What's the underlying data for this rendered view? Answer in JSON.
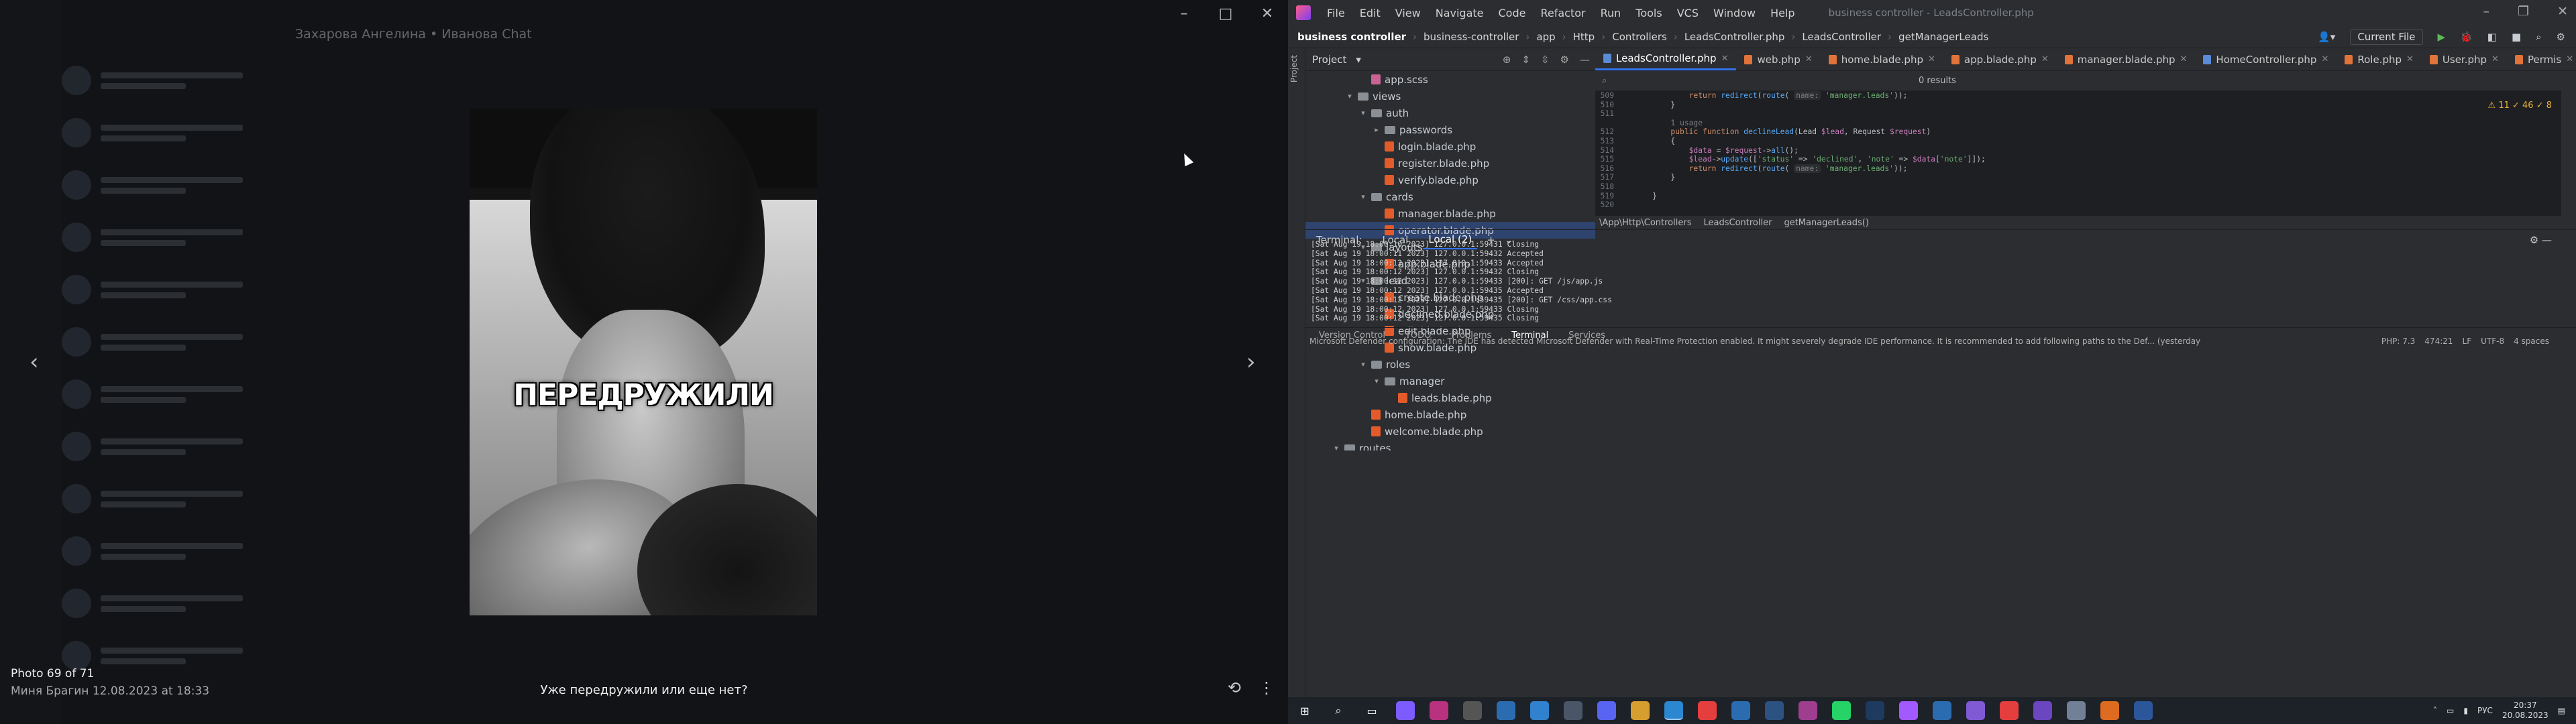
{
  "viewer": {
    "window_title": "Захарова Ангелина • Иванова Chat",
    "photo_caption": "ПЕРЕДРУЖИЛИ",
    "photo_counter": "Photo 69 of 71",
    "author_line": "Миня Брагин  12.08.2023 at 18:33",
    "message": "Уже передружили или еще нет?",
    "prev_icon": "‹",
    "next_icon": "›"
  },
  "ide": {
    "menu": [
      "File",
      "Edit",
      "View",
      "Navigate",
      "Code",
      "Refactor",
      "Run",
      "Tools",
      "VCS",
      "Window",
      "Help"
    ],
    "window_title": "business controller - LeadsController.php",
    "breadcrumbs": [
      "business controller",
      "business-controller",
      "app",
      "Http",
      "Controllers",
      "LeadsController.php",
      "LeadsController",
      "getManagerLeads"
    ],
    "run_config": "Current File",
    "project_label": "Project",
    "tree": [
      {
        "depth": 4,
        "kind": "scss",
        "label": "app.scss"
      },
      {
        "depth": 3,
        "kind": "folder",
        "open": true,
        "label": "views"
      },
      {
        "depth": 4,
        "kind": "folder",
        "open": true,
        "label": "auth"
      },
      {
        "depth": 5,
        "kind": "folder",
        "open": false,
        "label": "passwords"
      },
      {
        "depth": 5,
        "kind": "blade",
        "label": "login.blade.php"
      },
      {
        "depth": 5,
        "kind": "blade",
        "label": "register.blade.php"
      },
      {
        "depth": 5,
        "kind": "blade",
        "label": "verify.blade.php"
      },
      {
        "depth": 4,
        "kind": "folder",
        "open": true,
        "label": "cards"
      },
      {
        "depth": 5,
        "kind": "blade",
        "label": "manager.blade.php"
      },
      {
        "depth": 5,
        "kind": "blade",
        "label": "operator.blade.php",
        "selected": true
      },
      {
        "depth": 4,
        "kind": "folder",
        "open": true,
        "label": "layouts"
      },
      {
        "depth": 5,
        "kind": "blade",
        "label": "app.blade.php"
      },
      {
        "depth": 4,
        "kind": "folder",
        "open": true,
        "label": "lead"
      },
      {
        "depth": 5,
        "kind": "blade",
        "label": "create.blade.php"
      },
      {
        "depth": 5,
        "kind": "blade",
        "label": "declined.blade.php"
      },
      {
        "depth": 5,
        "kind": "blade",
        "label": "edit.blade.php"
      },
      {
        "depth": 5,
        "kind": "blade",
        "label": "show.blade.php"
      },
      {
        "depth": 4,
        "kind": "folder",
        "open": true,
        "label": "roles"
      },
      {
        "depth": 5,
        "kind": "folder",
        "open": true,
        "label": "manager"
      },
      {
        "depth": 6,
        "kind": "blade",
        "label": "leads.blade.php"
      },
      {
        "depth": 4,
        "kind": "blade",
        "label": "home.blade.php"
      },
      {
        "depth": 4,
        "kind": "blade",
        "label": "welcome.blade.php"
      },
      {
        "depth": 2,
        "kind": "folder",
        "open": true,
        "label": "routes"
      }
    ],
    "tabs": [
      {
        "label": "LeadsController.php",
        "icon": "c",
        "active": true
      },
      {
        "label": "web.php",
        "icon": "p"
      },
      {
        "label": "home.blade.php",
        "icon": "p"
      },
      {
        "label": "app.blade.php",
        "icon": "p"
      },
      {
        "label": "manager.blade.php",
        "icon": "p"
      },
      {
        "label": "HomeController.php",
        "icon": "c"
      },
      {
        "label": "Role.php",
        "icon": "p"
      },
      {
        "label": "User.php",
        "icon": "p"
      },
      {
        "label": "Permis",
        "icon": "p"
      }
    ],
    "search_results": "0 results",
    "inspections": "⚠ 11   ✓ 46   ✓ 8",
    "code_lines": [
      {
        "n": "509",
        "html": "            <span class='kw'>return</span> <span class='fn'>redirect</span>(<span class='fn'>route</span>( <span class='hint'>name:</span> <span class='str'>'manager.leads'</span>));"
      },
      {
        "n": "510",
        "html": "        }"
      },
      {
        "n": "511",
        "html": ""
      },
      {
        "n": "",
        "html": "        <span class='cm'>1 usage</span>"
      },
      {
        "n": "512",
        "html": "        <span class='kw'>public function</span> <span class='fn'>declineLead</span>(Lead <span class='var'>$lead</span>, Request <span class='var'>$request</span>)"
      },
      {
        "n": "513",
        "html": "        {"
      },
      {
        "n": "514",
        "html": "            <span class='var'>$data</span> = <span class='var'>$request</span>-><span class='fn'>all</span>();"
      },
      {
        "n": "515",
        "html": "            <span class='var'>$lead</span>-><span class='fn'>update</span>([<span class='str'>'status'</span> => <span class='str'>'declined'</span>, <span class='str'>'note'</span> => <span class='var'>$data</span>[<span class='str'>'note'</span>]]);"
      },
      {
        "n": "516",
        "html": "            <span class='kw'>return</span> <span class='fn'>redirect</span>(<span class='fn'>route</span>( <span class='hint'>name:</span> <span class='str'>'manager.leads'</span>));"
      },
      {
        "n": "517",
        "html": "        }"
      },
      {
        "n": "518",
        "html": ""
      },
      {
        "n": "519",
        "html": "    }"
      },
      {
        "n": "520",
        "html": ""
      }
    ],
    "code_path": [
      "\\App\\Http\\Controllers",
      "LeadsController",
      "getManagerLeads()"
    ],
    "terminal_tabs": [
      "Terminal:",
      "Local",
      "Local (2)"
    ],
    "terminal_lines": [
      "[Sat Aug 19 18:00:10 2023] 127.0.0.1:59431 Closing",
      "[Sat Aug 19 18:00:11 2023] 127.0.0.1:59432 Accepted",
      "[Sat Aug 19 18:00:12 2023] 127.0.0.1:59433 Accepted",
      "[Sat Aug 19 18:00:12 2023] 127.0.0.1:59432 Closing",
      "[Sat Aug 19 18:00:12 2023] 127.0.0.1:59433 [200]: GET /js/app.js",
      "[Sat Aug 19 18:00:12 2023] 127.0.0.1:59435 Accepted",
      "[Sat Aug 19 18:00:12 2023] 127.0.0.1:59435 [200]: GET /css/app.css",
      "[Sat Aug 19 18:00:12 2023] 127.0.0.1:59433 Closing",
      "[Sat Aug 19 18:00:12 2023] 127.0.0.1:59435 Closing"
    ],
    "bottom_tools": [
      "Version Control",
      "TODO",
      "Problems",
      "Terminal",
      "Services"
    ],
    "status_message": "Microsoft Defender configuration: The IDE has detected Microsoft Defender with Real-Time Protection enabled. It might severely degrade IDE performance. It is recommended to add following paths to the Def... (yesterday",
    "status_right": [
      "PHP: 7.3",
      "474:21",
      "LF",
      "UTF-8",
      "4 spaces"
    ]
  },
  "taskbar": {
    "lang": "РУС",
    "time": "20:37",
    "date": "20.08.2023"
  }
}
